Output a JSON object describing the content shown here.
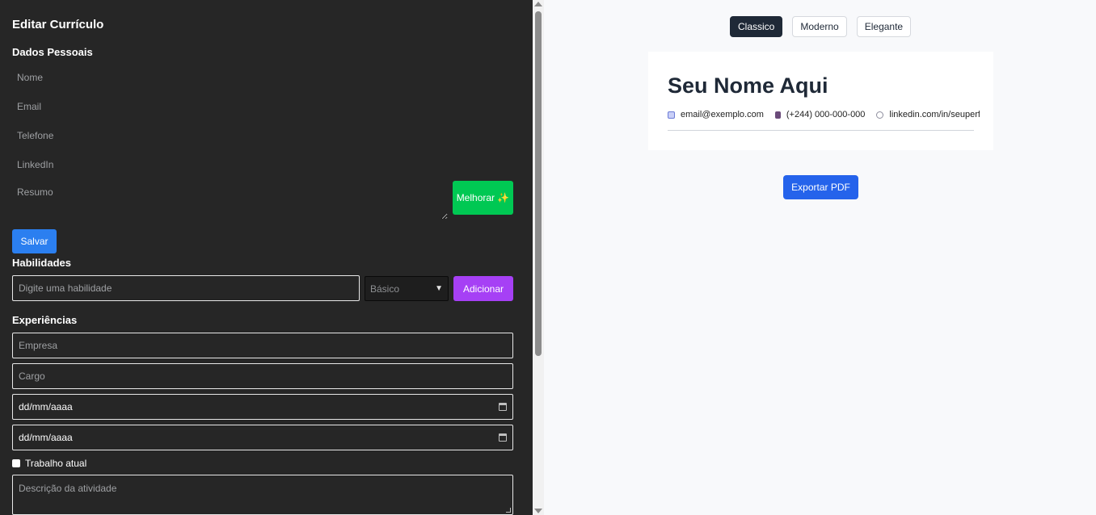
{
  "editor": {
    "title": "Editar Currículo",
    "personal": {
      "heading": "Dados Pessoais",
      "name_placeholder": "Nome",
      "email_placeholder": "Email",
      "phone_placeholder": "Telefone",
      "linkedin_placeholder": "LinkedIn",
      "summary_placeholder": "Resumo",
      "improve_label": "Melhorar ✨",
      "save_label": "Salvar"
    },
    "skills": {
      "heading": "Habilidades",
      "input_placeholder": "Digite uma habilidade",
      "level_selected": "Básico",
      "add_label": "Adicionar"
    },
    "experience": {
      "heading": "Experiências",
      "company_placeholder": "Empresa",
      "role_placeholder": "Cargo",
      "start_date": "dd/mm/aaaa",
      "end_date": "dd/mm/aaaa",
      "current_job_label": "Trabalho atual",
      "description_placeholder": "Descrição da atividade"
    }
  },
  "preview": {
    "themes": [
      "Classico",
      "Moderno",
      "Elegante"
    ],
    "active_theme": "Classico",
    "cv": {
      "name": "Seu Nome Aqui",
      "email": "email@exemplo.com",
      "phone": "(+244) 000-000-000",
      "linkedin": "linkedin.com/in/seuperfil"
    },
    "export_label": "Exportar PDF"
  },
  "colors": {
    "editor_bg": "#262626",
    "improve_button": "#00c853",
    "save_button": "#2b7ff0",
    "add_button": "#a640f5",
    "export_button": "#2563eb",
    "active_theme": "#1f2937"
  }
}
